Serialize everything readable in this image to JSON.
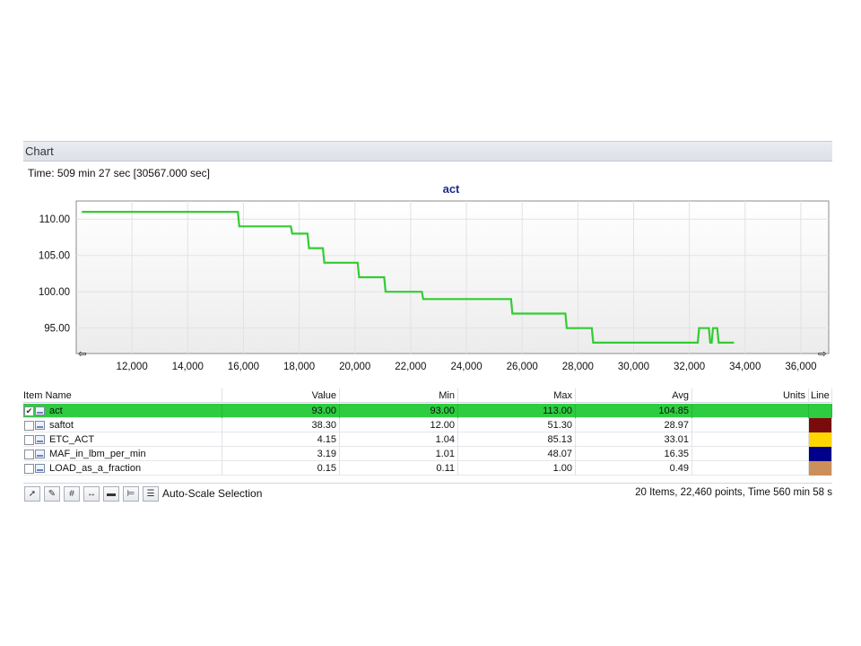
{
  "panel": {
    "title": "Chart"
  },
  "chart": {
    "time_readout": "Time: 509 min 27 sec [30567.000 sec]"
  },
  "chart_data": {
    "type": "line",
    "title": "act",
    "xlim": [
      10000,
      37000
    ],
    "ylim": [
      91.5,
      112.5
    ],
    "x_ticks": [
      12000,
      14000,
      16000,
      18000,
      20000,
      22000,
      24000,
      26000,
      28000,
      30000,
      32000,
      34000,
      36000
    ],
    "x_tick_labels": [
      "12,000",
      "14,000",
      "16,000",
      "18,000",
      "20,000",
      "22,000",
      "24,000",
      "26,000",
      "28,000",
      "30,000",
      "32,000",
      "34,000",
      "36,000"
    ],
    "y_ticks": [
      95,
      100,
      105,
      110
    ],
    "y_tick_labels": [
      "95.00",
      "100.00",
      "105.00",
      "110.00"
    ],
    "grid": true,
    "series": [
      {
        "color": "#33cc33",
        "x": [
          10200,
          15800,
          15850,
          17700,
          17750,
          18300,
          18350,
          18850,
          18900,
          20100,
          20150,
          21050,
          21100,
          22400,
          22450,
          25600,
          25650,
          27550,
          27600,
          28500,
          28550,
          32300,
          32350,
          32700,
          32750,
          32800,
          32850,
          33000,
          33050,
          33600
        ],
        "y": [
          111,
          111,
          109,
          109,
          108,
          108,
          106,
          106,
          104,
          104,
          102,
          102,
          100,
          100,
          99,
          99,
          97,
          97,
          95,
          95,
          93,
          93,
          95,
          95,
          93,
          93,
          95,
          95,
          93,
          93
        ]
      }
    ]
  },
  "grid": {
    "headers": {
      "name": "Item Name",
      "value": "Value",
      "min": "Min",
      "max": "Max",
      "avg": "Avg",
      "units": "Units",
      "line": "Line"
    },
    "rows": [
      {
        "name": "act",
        "value": "93.00",
        "min": "93.00",
        "max": "113.00",
        "avg": "104.85",
        "units": "",
        "checked": "✔",
        "color": "#2ecc40"
      },
      {
        "name": "saftot",
        "value": "38.30",
        "min": "12.00",
        "max": "51.30",
        "avg": "28.97",
        "units": "",
        "checked": "",
        "color": "#7a0b0b"
      },
      {
        "name": "ETC_ACT",
        "value": "4.15",
        "min": "1.04",
        "max": "85.13",
        "avg": "33.01",
        "units": "",
        "checked": "",
        "color": "#ffd700"
      },
      {
        "name": "MAF_in_lbm_per_min",
        "value": "3.19",
        "min": "1.01",
        "max": "48.07",
        "avg": "16.35",
        "units": "",
        "checked": "",
        "color": "#00008b"
      },
      {
        "name": "LOAD_as_a_fraction",
        "value": "0.15",
        "min": "0.11",
        "max": "1.00",
        "avg": "0.49",
        "units": "",
        "checked": "",
        "color": "#cd8f5a"
      }
    ]
  },
  "toolbar": {
    "buttons": [
      "line-style-icon",
      "color-icon",
      "hash-icon",
      "range-icon",
      "horizontal-line-icon",
      "threshold-icon",
      "legend-icon"
    ],
    "autoscale_label": "Auto-Scale Selection",
    "status": "20 Items, 22,460 points, Time 560 min 58 s"
  }
}
